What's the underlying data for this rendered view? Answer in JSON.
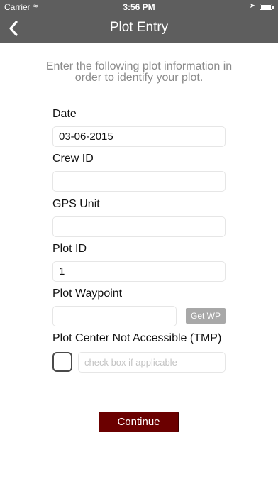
{
  "status_bar": {
    "carrier": "Carrier",
    "time": "3:56 PM"
  },
  "nav": {
    "title": "Plot Entry",
    "back_icon": "chevron-left-icon"
  },
  "intro": "Enter the following plot information in order to identify your plot.",
  "form": {
    "date": {
      "label": "Date",
      "value": "03-06-2015"
    },
    "crew_id": {
      "label": "Crew ID",
      "value": ""
    },
    "gps_unit": {
      "label": "GPS Unit",
      "value": ""
    },
    "plot_id": {
      "label": "Plot ID",
      "value": "1"
    },
    "plot_waypoint": {
      "label": "Plot Waypoint",
      "value": "",
      "button": "Get WP"
    },
    "plot_center": {
      "label": "Plot Center Not Accessible (TMP)",
      "placeholder": "check box if applicable",
      "checked": false
    }
  },
  "continue_label": "Continue",
  "colors": {
    "header": "#5e5e5e",
    "continue": "#6b0000",
    "get_wp": "#a8a8a8"
  }
}
